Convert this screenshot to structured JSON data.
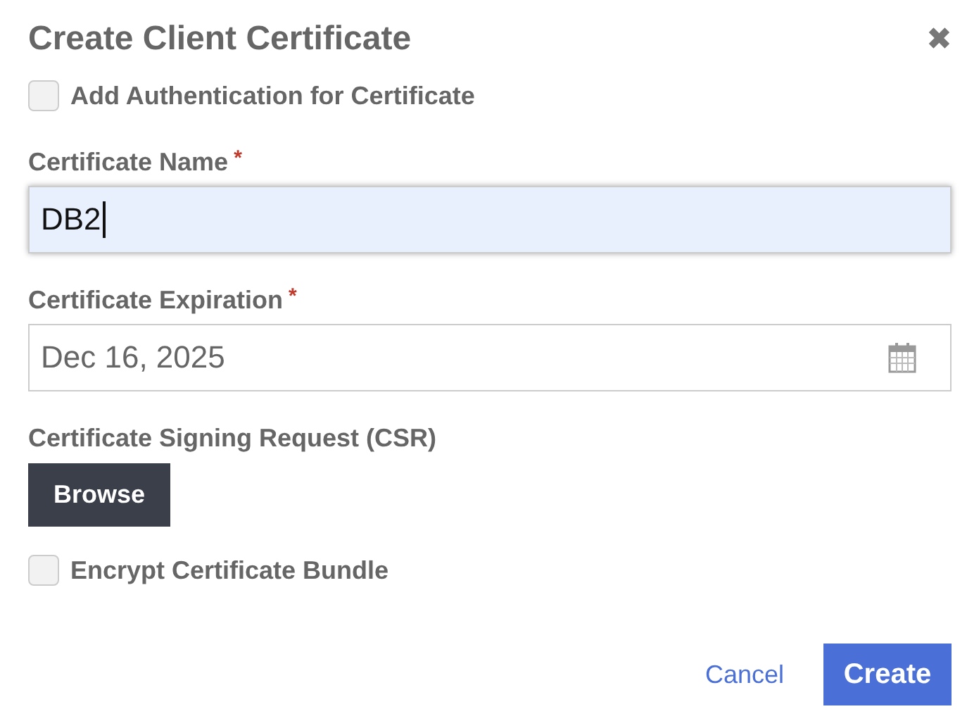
{
  "dialog": {
    "title": "Create Client Certificate",
    "close": "✖"
  },
  "fields": [
    {
      "kind": "checkbox",
      "label": "Add Authentication for Certificate",
      "checked": false
    },
    {
      "kind": "text",
      "label": "Certificate Name",
      "required_mark": "*",
      "value": "DB2",
      "focused": true
    },
    {
      "kind": "date",
      "label": "Certificate Expiration",
      "required_mark": "*",
      "value": "Dec 16, 2025",
      "focused": false
    },
    {
      "kind": "file",
      "label": "Certificate Signing Request (CSR)",
      "button": "Browse"
    },
    {
      "kind": "checkbox",
      "label": "Encrypt Certificate Bundle",
      "checked": false
    }
  ],
  "buttons": [
    {
      "kind": "link",
      "label": "Cancel"
    },
    {
      "kind": "primary",
      "label": "Create"
    }
  ]
}
